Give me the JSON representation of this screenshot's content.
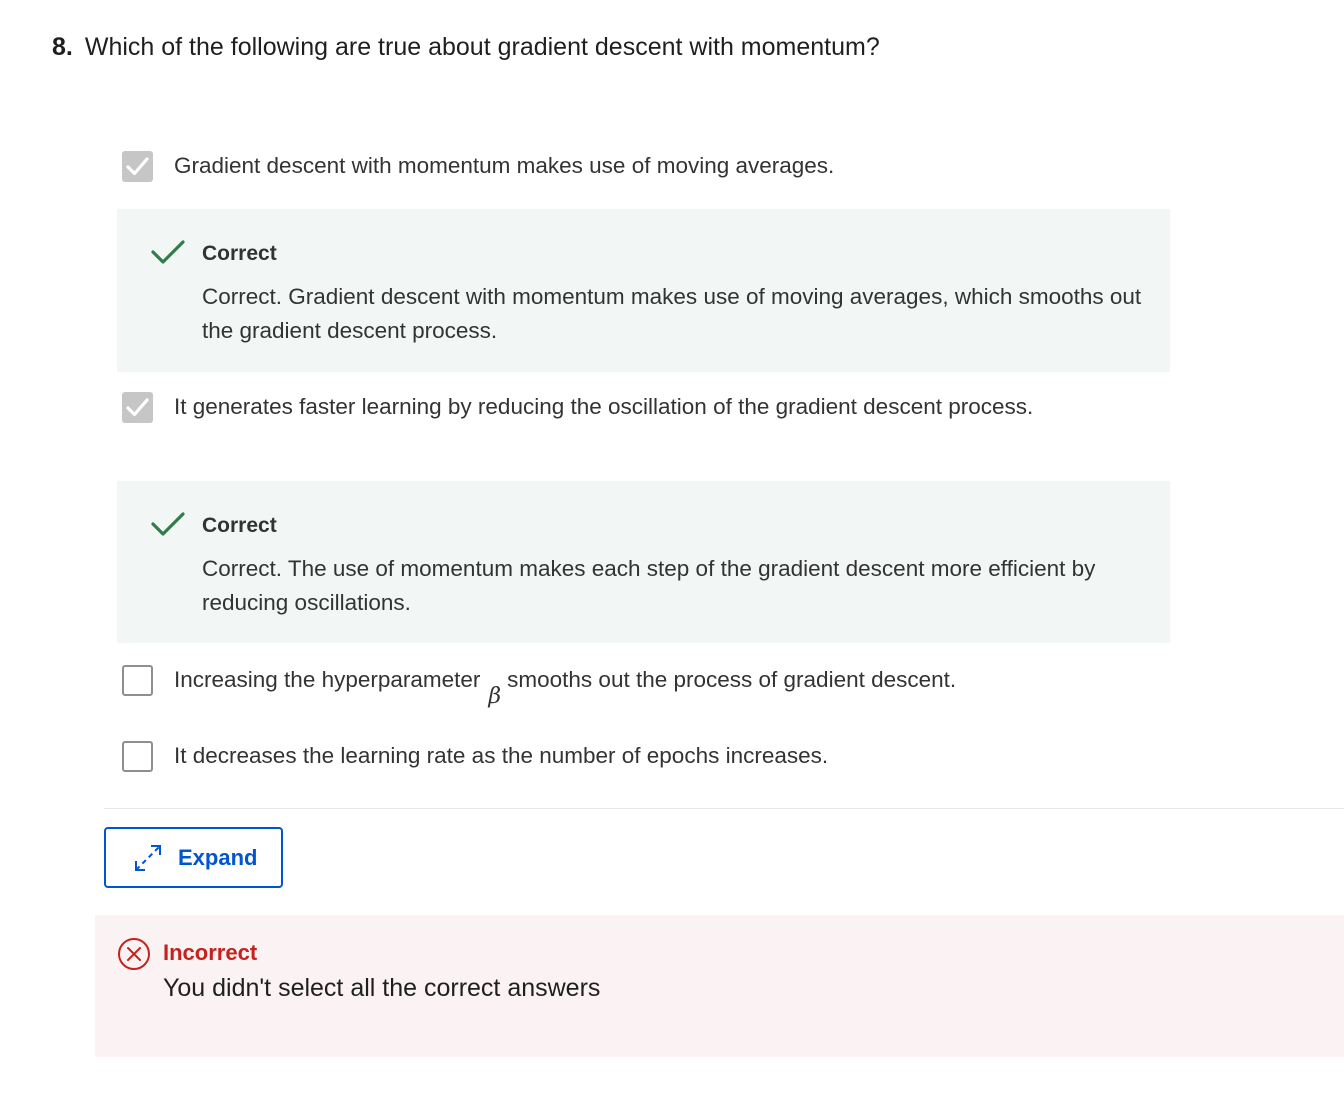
{
  "question": {
    "number": "8.",
    "text": "Which of the following are true about gradient descent with momentum?"
  },
  "options": [
    {
      "text": "Gradient descent with momentum makes use of moving averages.",
      "checked": true,
      "feedback": {
        "title": "Correct",
        "text": "Correct. Gradient descent with momentum makes use of moving averages, which smooths out the gradient descent process."
      }
    },
    {
      "text": "It generates faster learning by reducing the oscillation of the gradient descent process.",
      "checked": true,
      "feedback": {
        "title": "Correct",
        "text": "Correct. The use of momentum makes each step of the gradient descent more efficient by reducing oscillations."
      }
    },
    {
      "text_before": "Increasing the hyperparameter",
      "symbol": "β",
      "text_after": "smooths out the process of gradient descent.",
      "checked": false
    },
    {
      "text": "It decreases the learning rate as the number of epochs increases.",
      "checked": false
    }
  ],
  "expand_button": {
    "label": "Expand",
    "icon": "expand-arrows-icon"
  },
  "result": {
    "title": "Incorrect",
    "text": "You didn't select all the correct answers",
    "icon": "x-circle-icon"
  },
  "colors": {
    "correct_green": "#2e7d4a",
    "feedback_bg": "#f2f7f5",
    "incorrect_red": "#c5221f",
    "incorrect_bg": "#fbf3f3",
    "accent_blue": "#0056d2",
    "checkbox_checked": "#c6c6c6"
  }
}
